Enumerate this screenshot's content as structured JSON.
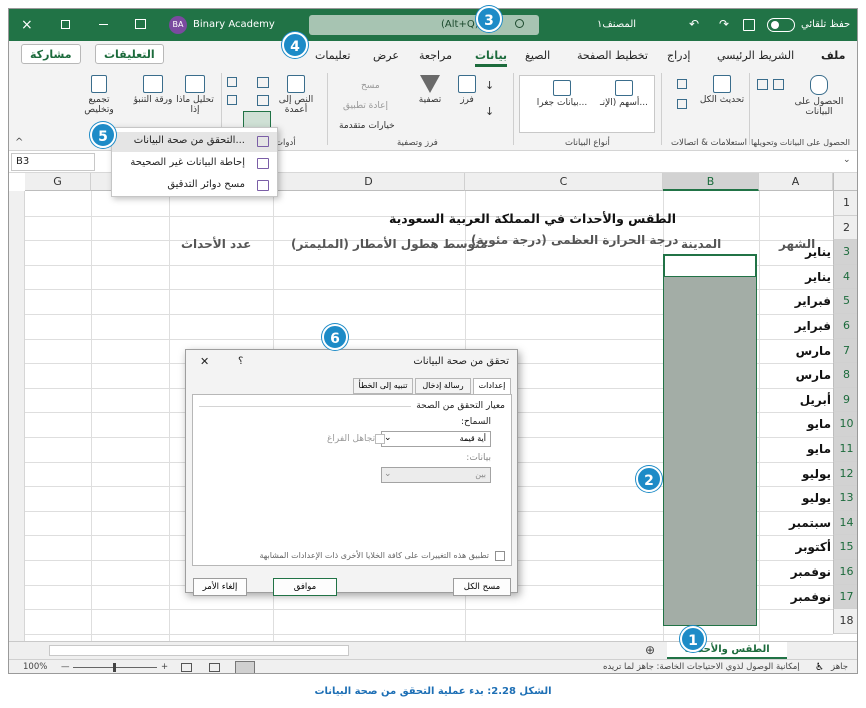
{
  "title_bar": {
    "close": "×",
    "account_initials": "BA",
    "account_name": "Binary Academy",
    "search_shortcut": "(Alt+Q)",
    "workbook_name": "المصنف١",
    "autosave_label": "حفظ تلقائي"
  },
  "menu": {
    "file": "ملف",
    "home": "الشريط الرئيسي",
    "insert": "إدراج",
    "page_layout": "تخطيط الصفحة",
    "formulas": "الصيغ",
    "data": "بيانات",
    "review": "مراجعة",
    "view": "عرض",
    "help": "تعليمات",
    "comments": "التعليقات",
    "share": "مشاركة"
  },
  "ribbon": {
    "get_data": "الحصول على البيانات",
    "refresh_all": "تحديث الكل",
    "stocks": "أسهم (الإنـ...",
    "geography": "بيانات جغرا...",
    "sort": "فرز",
    "filter": "تصفية",
    "clear": "مسح",
    "reapply": "إعادة تطبيق",
    "advanced": "خيارات متقدمة",
    "text_to_columns": "النص إلى أعمدة",
    "what_if": "تحليل ماذا إذا",
    "forecast_sheet": "ورقة التنبؤ",
    "outline": "تجميع وتخليص",
    "groups": {
      "get_transform": "الحصول على البيانات وتحويلها",
      "queries": "استعلامات & اتصالات",
      "data_types": "أنواع البيانات",
      "sort_filter": "فرز وتصفية",
      "tools": "أدوات"
    }
  },
  "formula_bar": {
    "name_box": "B3"
  },
  "dropdown_menu": {
    "items": [
      {
        "label": "التحقق من صحة البيانات..."
      },
      {
        "label": "إحاطة البيانات غير الصحيحة"
      },
      {
        "label": "مسح دوائر التدقيق"
      }
    ]
  },
  "sheet": {
    "columns": [
      "A",
      "B",
      "C",
      "D",
      "G"
    ],
    "rows": [
      "1",
      "2",
      "3",
      "4",
      "5",
      "6",
      "7",
      "8",
      "9",
      "10",
      "11",
      "12",
      "13",
      "14",
      "15",
      "16",
      "17",
      "18"
    ],
    "title": "الطقس والأحداث في المملكة العربية السعودية",
    "headers": {
      "month": "الشهر",
      "city": "المدينة",
      "max_temp": "درجة الحرارة العظمى (درجة مئوية)",
      "rainfall": "متوسط هطول الأمطار (المليمتر)",
      "events": "عدد الأحداث"
    },
    "months": [
      "يناير",
      "يناير",
      "فبراير",
      "فبراير",
      "مارس",
      "مارس",
      "أبريل",
      "مايو",
      "مايو",
      "يوليو",
      "يوليو",
      "سبتمبر",
      "أكتوبر",
      "نوفمبر",
      "نوفمبر"
    ]
  },
  "dialog": {
    "title": "تحقق من صحة البيانات",
    "help": "؟",
    "close": "✕",
    "tabs": [
      "إعدادات",
      "رسالة إدخال",
      "تنبيه إلى الخطأ"
    ],
    "criteria_label": "معيار التحقق من الصحة",
    "allow_label": "السماح:",
    "allow_value": "أية قيمة",
    "ignore_blank": "تجاهل الفراغ",
    "data_label": "بيانات:",
    "data_value": "بين",
    "apply_all": "تطبيق هذه التغييرات على كافة الخلايا الأخرى ذات الإعدادات المشابهة",
    "clear_all": "مسح الكل",
    "ok": "موافق",
    "cancel": "إلغاء الأمر"
  },
  "sheet_tab": "الطقس والأحداث",
  "status_bar": {
    "ready": "جاهز",
    "accessibility": "إمكانية الوصول لذوي الاحتياجات الخاصة: جاهز لما تريده",
    "zoom": "100%",
    "zoom_out": "—",
    "zoom_in": "+"
  },
  "callouts": [
    "1",
    "2",
    "3",
    "4",
    "5",
    "6"
  ],
  "caption": "الشكل 2.28: بدء عملية التحقق من صحة البيانات",
  "colors": {
    "excel_green": "#217346",
    "callout_blue": "#1d8bc7",
    "selection_gray": "#a3ada6"
  }
}
